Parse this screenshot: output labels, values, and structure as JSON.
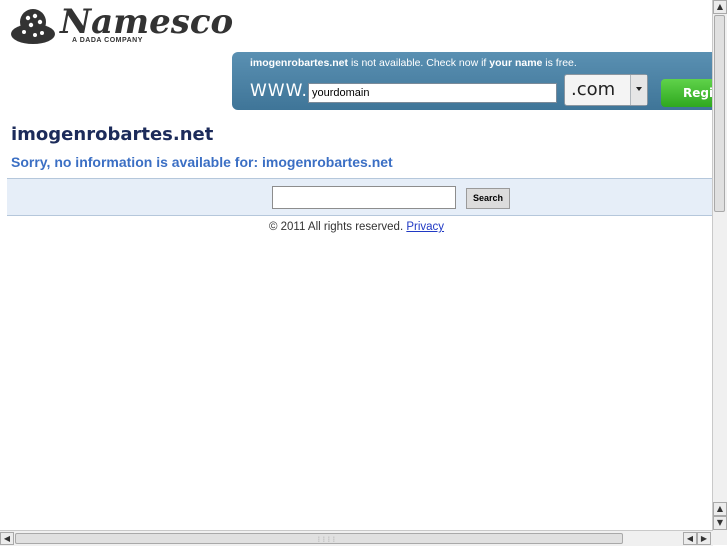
{
  "logo": {
    "text": "Namesco",
    "subtitle": "A DADA COMPANY"
  },
  "banner": {
    "domain": "imogenrobartes.net",
    "msg_mid": " is not available. Check now if ",
    "msg_bold": "your name",
    "msg_end": " is free.",
    "www_label": "WWW.",
    "domain_input_value": "yourdomain",
    "tld_selected": ".com",
    "register_label": "Register"
  },
  "main": {
    "title": "imogenrobartes.net",
    "sorry_text": "Sorry, no information is available for: imogenrobartes.net"
  },
  "search": {
    "input_value": "",
    "button_label": "Search"
  },
  "footer": {
    "copyright": "© 2011 All rights reserved.",
    "privacy_link": "Privacy"
  },
  "scrollbars": {
    "up": "▲",
    "down": "▼",
    "left": "◀",
    "right": "▶",
    "grip": "⋮⋮⋮⋮"
  }
}
